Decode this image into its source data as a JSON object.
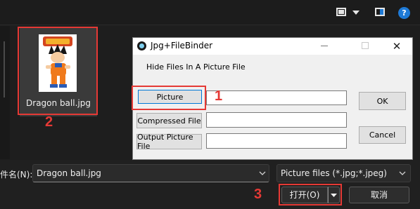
{
  "thumbnail": {
    "caption": "Dragon ball.jpg"
  },
  "annotations": {
    "one": "1",
    "two": "2",
    "three": "3"
  },
  "dialog": {
    "title": "Jpg+FileBinder",
    "heading": "Hide Files In A Picture File",
    "buttons": {
      "picture": "Picture",
      "compressed": "Compressed File",
      "output": "Output Picture File",
      "ok": "OK",
      "cancel": "Cancel"
    },
    "close_glyph": "✕"
  },
  "file_dialog": {
    "filename_label": "件名(N):",
    "filename_value": "Dragon ball.jpg",
    "filetype_value": "Picture files (*.jpg;*.jpeg)",
    "open_label": "打开(O)",
    "cancel_label": "取消"
  },
  "toolbar": {
    "help_glyph": "?"
  },
  "colors": {
    "accent": "#1e7ad6",
    "annotation": "#e53935"
  }
}
